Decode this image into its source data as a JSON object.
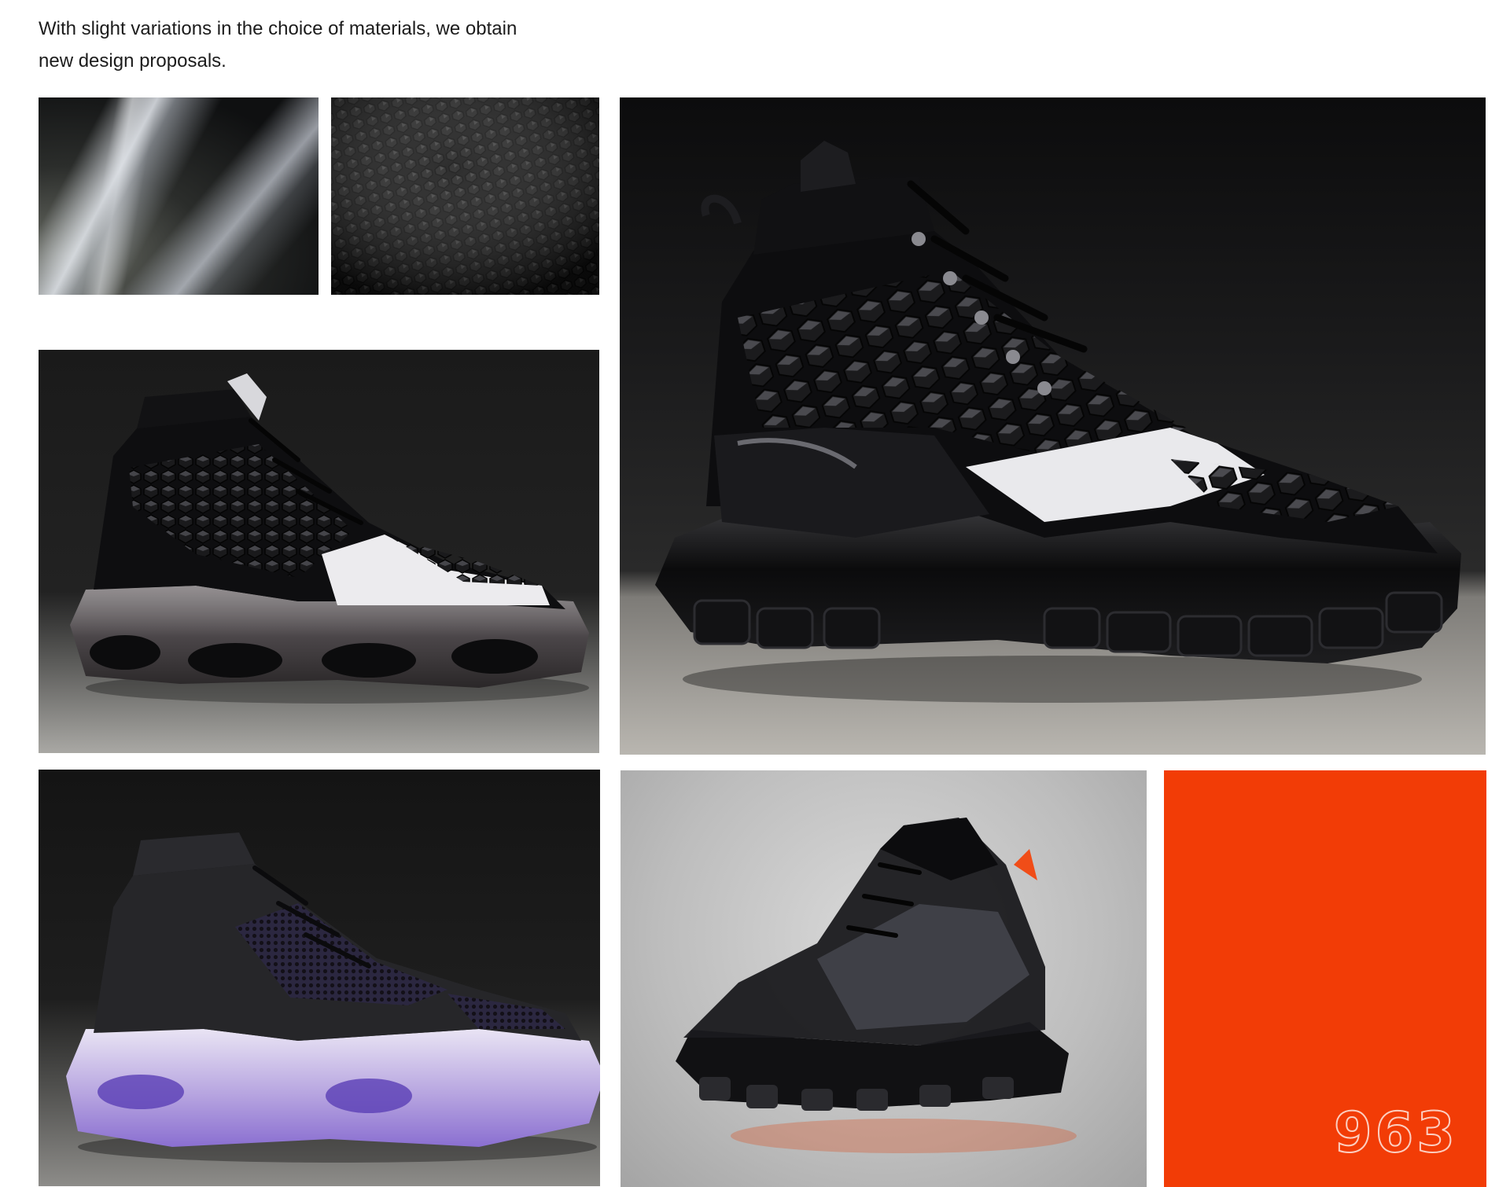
{
  "intro": {
    "line1": "With slight variations in the choice of materials, we obtain",
    "line2": "new design proposals."
  },
  "swatches": [
    {
      "name": "glossy-patent-leather-swatch"
    },
    {
      "name": "hexagon-embossed-leather-swatch"
    }
  ],
  "photos": [
    {
      "name": "black-hexagon-patent-sneaker"
    },
    {
      "name": "black-white-hexagon-sneaker-clear-sole"
    },
    {
      "name": "black-knit-sneaker-purple-sole"
    },
    {
      "name": "translucent-black-trail-sneaker"
    }
  ],
  "brand": {
    "logo_text": "963",
    "color": "#f23c06"
  }
}
